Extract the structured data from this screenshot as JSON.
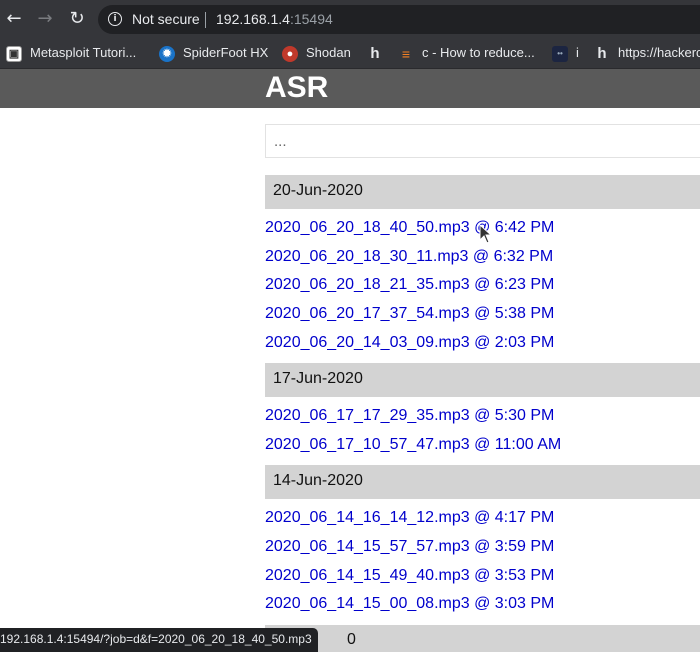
{
  "browser": {
    "security_label": "Not secure",
    "url_host": "192.168.1.4",
    "url_port": ":15494",
    "bookmarks": [
      {
        "label": "Metasploit Tutori...",
        "icon": "metasploit-icon"
      },
      {
        "label": "SpiderFoot HX",
        "icon": "spiderfoot-icon"
      },
      {
        "label": "Shodan",
        "icon": "shodan-icon"
      },
      {
        "label": "",
        "icon": "hackerone-icon"
      },
      {
        "label": "c - How to reduce...",
        "icon": "stackoverflow-icon"
      },
      {
        "label": "i",
        "icon": "dark-site-icon"
      },
      {
        "label": "https://hackerc",
        "icon": "hackerone-icon"
      }
    ],
    "status_url": "192.168.1.4:15494/?job=d&f=2020_06_20_18_40_50.mp3"
  },
  "page": {
    "title": "ASR",
    "search_placeholder": "..."
  },
  "groups": [
    {
      "date": "20-Jun-2020",
      "items": [
        "2020_06_20_18_40_50.mp3 @ 6:42 PM",
        "2020_06_20_18_30_11.mp3 @ 6:32 PM",
        "2020_06_20_18_21_35.mp3 @ 6:23 PM",
        "2020_06_20_17_37_54.mp3 @ 5:38 PM",
        "2020_06_20_14_03_09.mp3 @ 2:03 PM"
      ]
    },
    {
      "date": "17-Jun-2020",
      "items": [
        "2020_06_17_17_29_35.mp3 @ 5:30 PM",
        "2020_06_17_10_57_47.mp3 @ 11:00 AM"
      ]
    },
    {
      "date": "14-Jun-2020",
      "items": [
        "2020_06_14_16_14_12.mp3 @ 4:17 PM",
        "2020_06_14_15_57_57.mp3 @ 3:59 PM",
        "2020_06_14_15_49_40.mp3 @ 3:53 PM",
        "2020_06_14_15_00_08.mp3 @ 3:03 PM"
      ]
    },
    {
      "date": "0",
      "items": []
    }
  ]
}
